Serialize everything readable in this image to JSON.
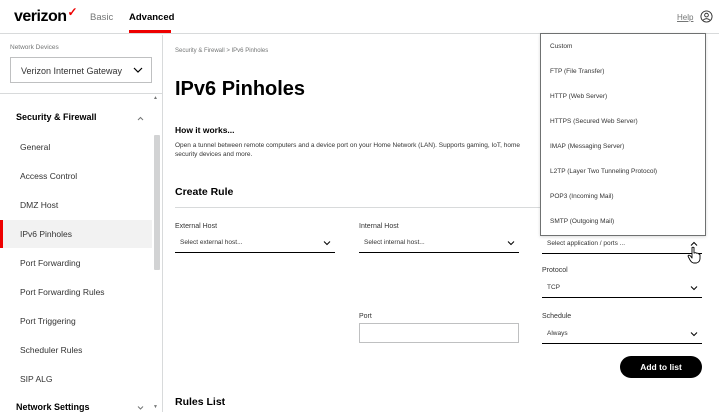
{
  "header": {
    "logo_text": "verizon",
    "logo_mark": "✓",
    "nav_basic": "Basic",
    "nav_advanced": "Advanced",
    "help": "Help"
  },
  "sidebar": {
    "devices_label": "Network Devices",
    "device_selected": "Verizon Internet Gateway",
    "section_security": "Security & Firewall",
    "items": [
      {
        "label": "General"
      },
      {
        "label": "Access Control"
      },
      {
        "label": "DMZ Host"
      },
      {
        "label": "IPv6 Pinholes"
      },
      {
        "label": "Port Forwarding"
      },
      {
        "label": "Port Forwarding Rules"
      },
      {
        "label": "Port Triggering"
      },
      {
        "label": "Scheduler Rules"
      },
      {
        "label": "SIP ALG"
      }
    ],
    "section_network": "Network Settings"
  },
  "main": {
    "breadcrumb": "Security & Firewall  >  IPv6 Pinholes",
    "title": "IPv6 Pinholes",
    "how_title": "How it works...",
    "how_desc": "Open a tunnel between remote computers and a device port on your Home Network (LAN). Supports gaming, IoT, home security devices and more.",
    "create_title": "Create Rule",
    "external_host_label": "External Host",
    "external_host_value": "Select external host...",
    "internal_host_label": "Internal Host",
    "internal_host_value": "Select internal host...",
    "application_value": "Select application / ports ...",
    "protocol_label": "Protocol",
    "protocol_value": "TCP",
    "port_label": "Port",
    "schedule_label": "Schedule",
    "schedule_value": "Always",
    "add_button": "Add to list",
    "rules_title": "Rules List"
  },
  "dropdown": {
    "options": [
      "Custom",
      "FTP (File Transfer)",
      "HTTP (Web Server)",
      "HTTPS (Secured Web Server)",
      "IMAP (Messaging Server)",
      "L2TP (Layer Two Tunneling Protocol)",
      "POP3 (Incoming Mail)",
      "SMTP (Outgoing Mail)"
    ]
  },
  "colors": {
    "brand_red": "#ee0000",
    "button_black": "#000000",
    "border_gray": "#d8dadb"
  }
}
